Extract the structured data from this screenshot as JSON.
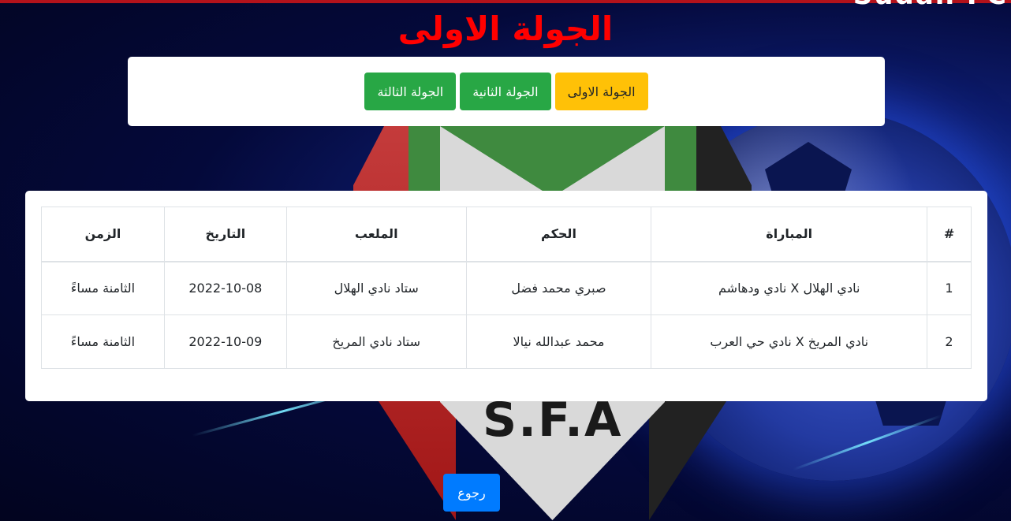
{
  "corner_text": "Sudan FC",
  "page_title": "الجولة الاولى",
  "rounds": [
    {
      "label": "الجولة الاولى",
      "active": true
    },
    {
      "label": "الجولة الثانية",
      "active": false
    },
    {
      "label": "الجولة الثالثة",
      "active": false
    }
  ],
  "background_logo_text": "S.F.A",
  "table": {
    "headers": {
      "num": "#",
      "match": "المباراة",
      "referee": "الحكم",
      "stadium": "الملعب",
      "date": "التاريخ",
      "time": "الزمن"
    },
    "rows": [
      {
        "num": "1",
        "match": "نادي الهلال X نادي ودهاشم",
        "referee": "صبري محمد فضل",
        "stadium": "ستاد نادي الهلال",
        "date": "2022-10-08",
        "time": "الثامنة مساءً"
      },
      {
        "num": "2",
        "match": "نادي المريخ X نادي حي العرب",
        "referee": "محمد عبدالله نيالا",
        "stadium": "ستاد نادي المريخ",
        "date": "2022-10-09",
        "time": "الثامنة مساءً"
      }
    ]
  },
  "back_button": "رجوع",
  "colors": {
    "title": "#ff0000",
    "active_round": "#ffc107",
    "round": "#28a745",
    "back_button": "#007bff",
    "top_line": "#b3121b"
  }
}
